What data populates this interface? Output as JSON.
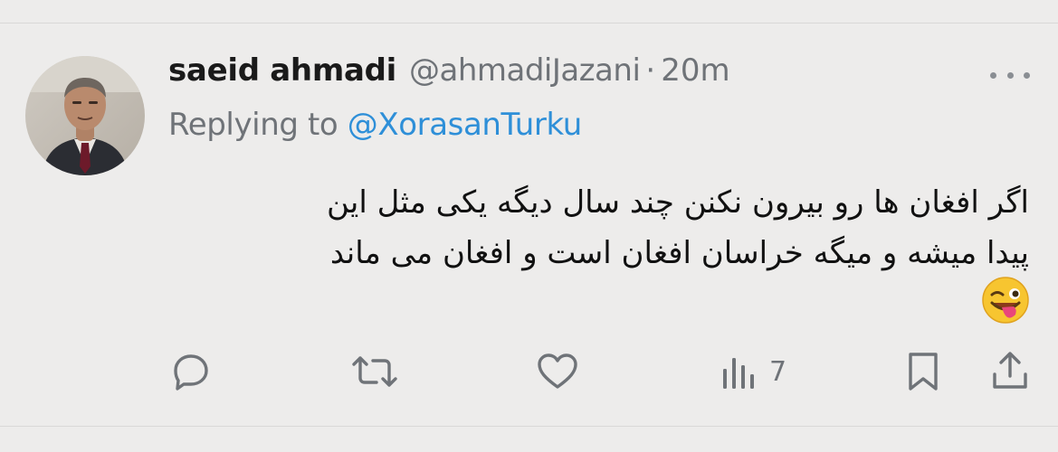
{
  "tweet": {
    "author_name": "saeid ahmadi",
    "author_handle": "@ahmadiJazani",
    "separator": "·",
    "time": "20m",
    "replying_prefix": "Replying to",
    "replying_to": "@XorasanTurku",
    "text_line1": "اگر افغان ها رو بیرون نکنن چند سال دیگه یکی مثل این",
    "text_line2": "پیدا میشه و میگه خراسان افغان است و افغان می ماند",
    "emoji": "winking-face-with-tongue"
  },
  "actions": {
    "reply_icon": "reply-icon",
    "retweet_icon": "retweet-icon",
    "like_icon": "like-icon",
    "views_icon": "views-icon",
    "views_count": "7",
    "bookmark_icon": "bookmark-icon",
    "share_icon": "share-icon"
  },
  "colors": {
    "background": "#edeceb",
    "text": "#1a1a1a",
    "muted": "#6f7378",
    "link": "#2e8fd8"
  }
}
